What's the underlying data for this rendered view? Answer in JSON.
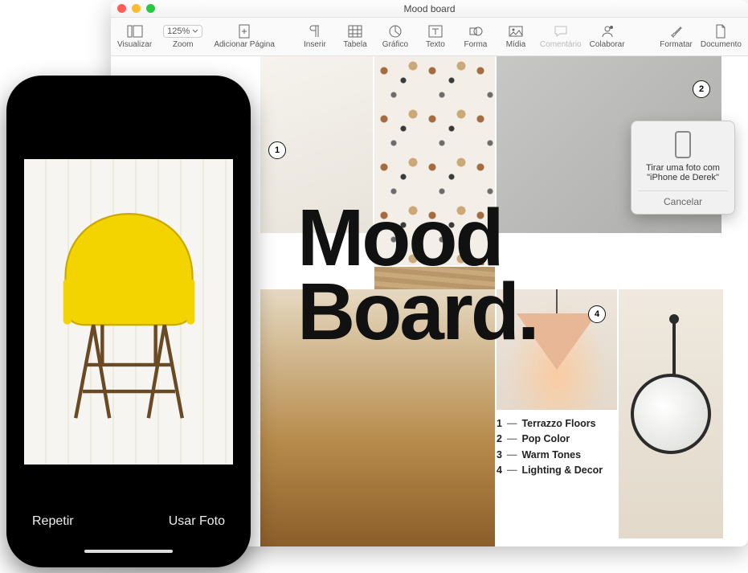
{
  "window": {
    "title": "Mood board"
  },
  "toolbar": {
    "visualizar": "Visualizar",
    "zoom_label": "Zoom",
    "zoom_value": "125%",
    "add_page": "Adicionar Página",
    "insert": "Inserir",
    "table": "Tabela",
    "chart": "Gráfico",
    "text": "Texto",
    "shape": "Forma",
    "media": "Mídia",
    "comment": "Comentário",
    "collaborate": "Colaborar",
    "format": "Formatar",
    "document": "Documento"
  },
  "doc": {
    "big_title_line1": "Mood",
    "big_title_line2": "Board.",
    "badge1": "1",
    "badge2": "2",
    "badge4": "4",
    "legend": [
      {
        "n": "1",
        "t": "Terrazzo Floors"
      },
      {
        "n": "2",
        "t": "Pop Color"
      },
      {
        "n": "3",
        "t": "Warm Tones"
      },
      {
        "n": "4",
        "t": "Lighting & Decor"
      }
    ]
  },
  "popover": {
    "line1": "Tirar uma foto com",
    "line2": "\"iPhone de Derek\"",
    "cancel": "Cancelar"
  },
  "iphone": {
    "retake": "Repetir",
    "use": "Usar Foto"
  }
}
